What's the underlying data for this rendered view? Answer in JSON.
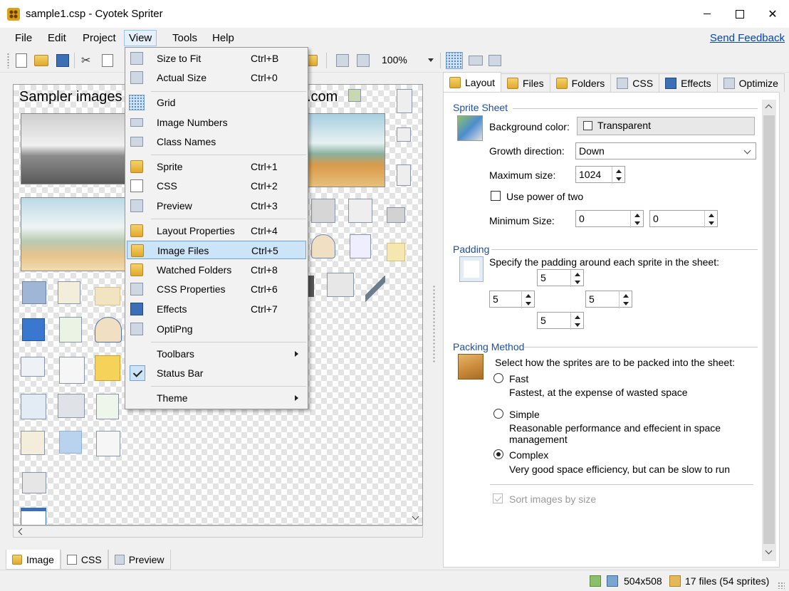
{
  "window": {
    "title": "sample1.csp - Cyotek Spriter",
    "close_glyph": "✕"
  },
  "menubar": {
    "items": [
      "File",
      "Edit",
      "Project",
      "View",
      "Tools",
      "Help"
    ],
    "active": "View",
    "feedback": "Send Feedback"
  },
  "toolbar": {
    "zoom_value": "100%"
  },
  "canvas": {
    "title_left": "Sampler images",
    "title_right": ".com"
  },
  "bottom_tabs": [
    "Image",
    "CSS",
    "Preview"
  ],
  "view_menu": {
    "items": [
      {
        "label": "Size to Fit",
        "shortcut": "Ctrl+B",
        "icon": "zoom-fit-icon"
      },
      {
        "label": "Actual Size",
        "shortcut": "Ctrl+0",
        "icon": "zoom-actual-icon"
      },
      {
        "label": "Grid",
        "shortcut": "",
        "icon": "grid-icon"
      },
      {
        "label": "Image Numbers",
        "shortcut": "",
        "icon": "image-numbers-icon"
      },
      {
        "label": "Class Names",
        "shortcut": "",
        "icon": "class-names-icon"
      },
      {
        "label": "Sprite",
        "shortcut": "Ctrl+1",
        "icon": "sprite-icon"
      },
      {
        "label": "CSS",
        "shortcut": "Ctrl+2",
        "icon": "css-icon"
      },
      {
        "label": "Preview",
        "shortcut": "Ctrl+3",
        "icon": "preview-icon"
      },
      {
        "label": "Layout Properties",
        "shortcut": "Ctrl+4",
        "icon": "layout-icon"
      },
      {
        "label": "Image Files",
        "shortcut": "Ctrl+5",
        "icon": "image-files-icon"
      },
      {
        "label": "Watched Folders",
        "shortcut": "Ctrl+8",
        "icon": "watched-folders-icon"
      },
      {
        "label": "CSS Properties",
        "shortcut": "Ctrl+6",
        "icon": "css-properties-icon"
      },
      {
        "label": "Effects",
        "shortcut": "Ctrl+7",
        "icon": "effects-icon"
      },
      {
        "label": "OptiPng",
        "shortcut": "",
        "icon": "optipng-icon"
      },
      {
        "label": "Toolbars",
        "shortcut": "",
        "submenu": true
      },
      {
        "label": "Status Bar",
        "shortcut": "",
        "checked": true
      },
      {
        "label": "Theme",
        "shortcut": "",
        "submenu": true
      }
    ],
    "highlighted": "Image Files"
  },
  "right_tabs": [
    "Layout",
    "Files",
    "Folders",
    "CSS",
    "Effects",
    "Optimize"
  ],
  "layout_panel": {
    "sprite_sheet": {
      "title": "Sprite Sheet",
      "background_label": "Background color:",
      "background_value": "Transparent",
      "growth_label": "Growth direction:",
      "growth_value": "Down",
      "max_size_label": "Maximum size:",
      "max_size_value": "1024",
      "power_of_two_label": "Use power of two",
      "min_size_label": "Minimum Size:",
      "min_w": "0",
      "min_h": "0"
    },
    "padding": {
      "title": "Padding",
      "description": "Specify the padding around each sprite in the sheet:",
      "top": "5",
      "left": "5",
      "right": "5",
      "bottom": "5"
    },
    "packing": {
      "title": "Packing Method",
      "description": "Select how the sprites are to be packed into the sheet:",
      "options": [
        {
          "label": "Fast",
          "desc": "Fastest, at the expense of wasted space",
          "checked": false
        },
        {
          "label": "Simple",
          "desc": "Reasonable performance and effecient in space management",
          "checked": false
        },
        {
          "label": "Complex",
          "desc": "Very good space efficiency, but can be slow to run",
          "checked": true
        }
      ],
      "sort_label": "Sort images by size"
    }
  },
  "statusbar": {
    "dimensions": "504x508",
    "files": "17 files (54 sprites)"
  },
  "colors": {
    "accent_link": "#0645ad",
    "section_title": "#1e4e9a",
    "menu_highlight": "#cce4f7"
  }
}
